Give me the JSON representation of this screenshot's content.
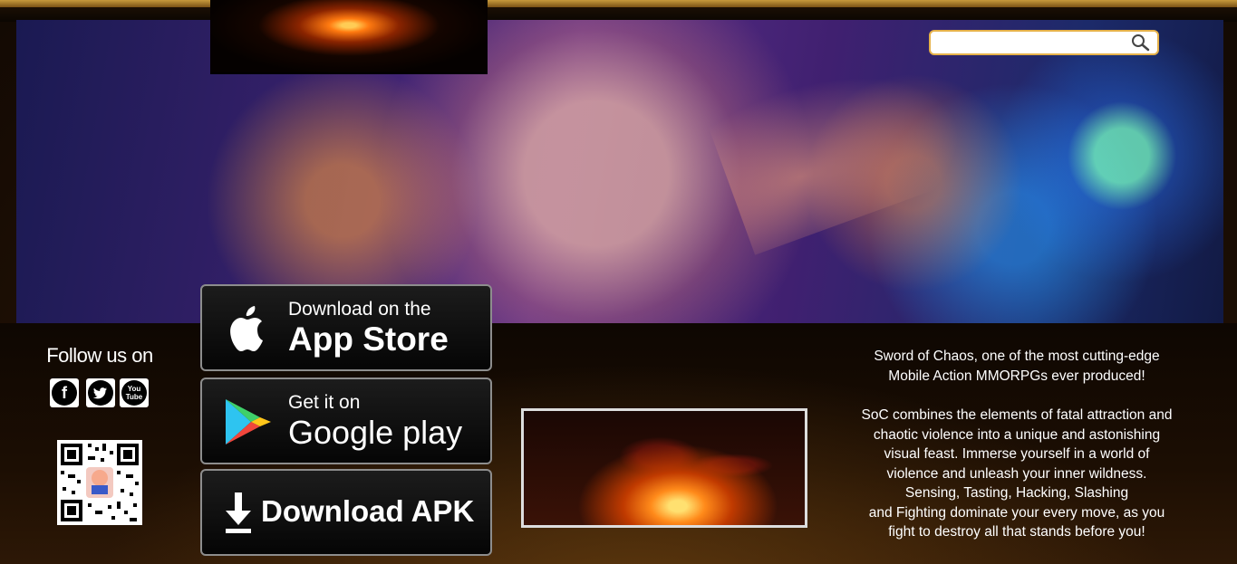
{
  "header": {
    "search": {
      "placeholder": "",
      "icon": "search-icon"
    }
  },
  "social": {
    "follow_label": "Follow us on",
    "items": [
      {
        "name": "facebook",
        "glyph": "f",
        "icon": "facebook-icon"
      },
      {
        "name": "twitter",
        "icon": "twitter-icon"
      },
      {
        "name": "youtube",
        "glyph": "You Tube",
        "icon": "youtube-icon"
      }
    ]
  },
  "downloads": {
    "app_store": {
      "line1": "Download on the",
      "line2": "App Store",
      "icon": "apple-icon"
    },
    "google_play": {
      "line1": "Get it on",
      "line2": "Google play",
      "icon": "google-play-icon"
    },
    "apk": {
      "label": "Download APK",
      "icon": "download-icon"
    }
  },
  "description": {
    "tagline": [
      "Sword of Chaos, one of the most cutting-edge",
      "Mobile Action MMORPGs ever produced!"
    ],
    "body": [
      "SoC combines the elements of fatal attraction and",
      "chaotic violence into a unique and astonishing",
      "visual feast. Immerse yourself in a world of",
      "violence and unleash your inner wildness.",
      "Sensing, Tasting, Hacking, Slashing",
      "and Fighting dominate your every move, as you",
      "fight to destroy all that stands before you!"
    ]
  },
  "colors": {
    "accent_gold": "#e6b24a",
    "button_border": "#8d8d8d"
  }
}
